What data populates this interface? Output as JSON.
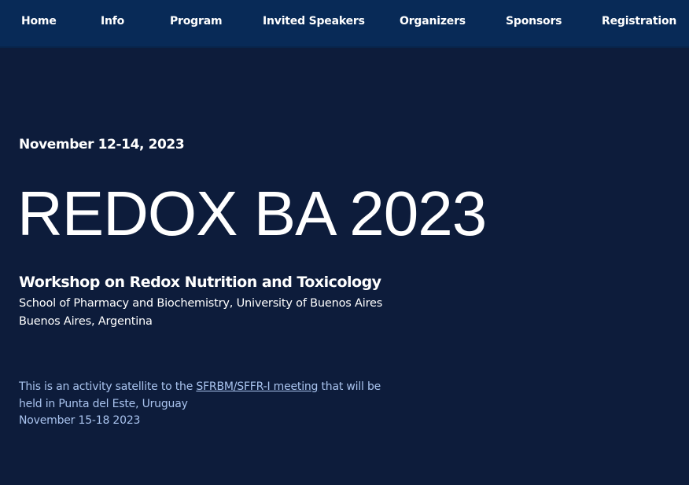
{
  "nav": {
    "items": [
      {
        "label": "Home"
      },
      {
        "label": "Info"
      },
      {
        "label": "Program"
      },
      {
        "label": "Invited Speakers"
      },
      {
        "label": "Organizers"
      },
      {
        "label": "Sponsors"
      },
      {
        "label": "Registration"
      }
    ]
  },
  "hero": {
    "dates": "November 12-14, 2023",
    "title": "REDOX BA 2023",
    "subtitle": "Workshop on Redox Nutrition and Toxicology",
    "affiliation_line1": "School of Pharmacy and Biochemistry, University of Buenos Aires",
    "affiliation_line2": "Buenos Aires, Argentina"
  },
  "satellite": {
    "text_before": "This is an activity satellite to the ",
    "link_text": "SFRBM/SFFR-I meeting",
    "text_after": " that will be held in Punta del Este, Uruguay",
    "dates": "November 15-18 2023"
  },
  "colors": {
    "background": "#0d1c3b",
    "nav_background": "#082a57",
    "satellite_text": "#a9c3ee"
  }
}
